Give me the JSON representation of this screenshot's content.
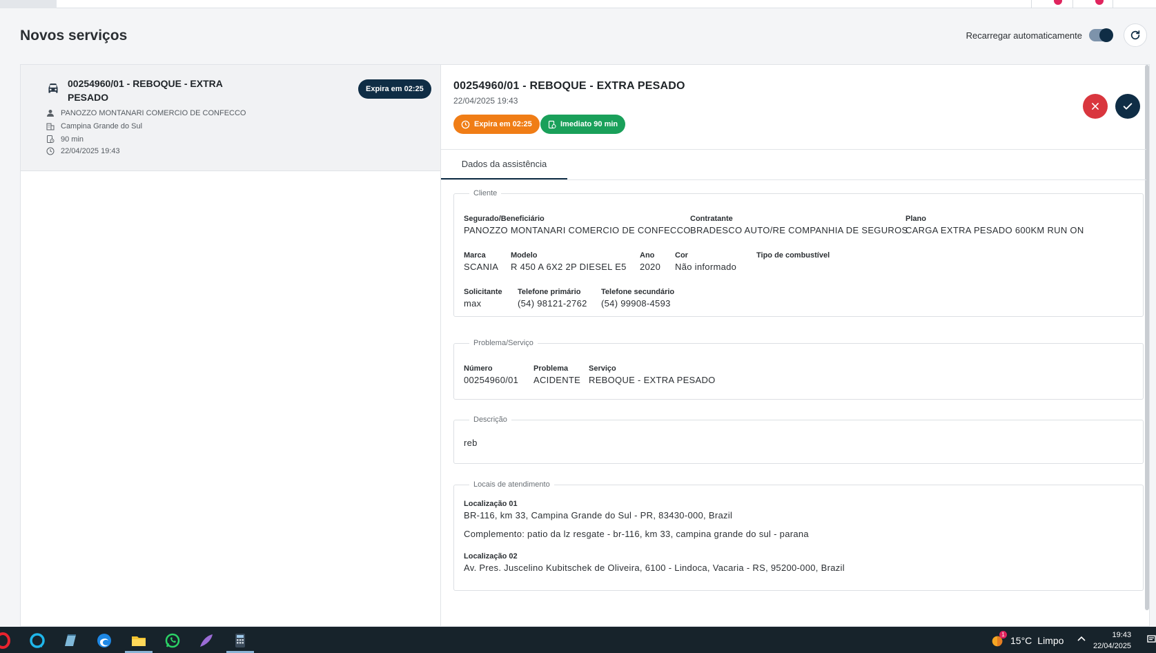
{
  "page": {
    "title": "Novos serviços",
    "auto_reload_label": "Recarregar automaticamente",
    "auto_reload_on": true
  },
  "list": {
    "items": [
      {
        "title": "00254960/01 - REBOQUE - EXTRA PESADO",
        "expire_badge": "Expira em 02:25",
        "client": "PANOZZO MONTANARI COMERCIO DE CONFECCO",
        "city": "Campina Grande do Sul",
        "duration": "90 min",
        "datetime": "22/04/2025 19:43"
      }
    ]
  },
  "detail": {
    "title": "00254960/01 - REBOQUE - EXTRA PESADO",
    "datetime": "22/04/2025 19:43",
    "chip_expire": "Expira em 02:25",
    "chip_immediate": "Imediato 90 min",
    "tab_label": "Dados da assistência",
    "cliente": {
      "legend": "Cliente",
      "segurado_label": "Segurado/Beneficiário",
      "segurado": "PANOZZO MONTANARI COMERCIO DE CONFECCO",
      "contratante_label": "Contratante",
      "contratante": "BRADESCO AUTO/RE COMPANHIA DE SEGUROS",
      "plano_label": "Plano",
      "plano": "CARGA EXTRA PESADO 600KM RUN ON",
      "marca_label": "Marca",
      "marca": "SCANIA",
      "modelo_label": "Modelo",
      "modelo": "R 450 A 6X2 2P DIESEL E5",
      "ano_label": "Ano",
      "ano": "2020",
      "cor_label": "Cor",
      "cor": "Não informado",
      "combustivel_label": "Tipo de combustível",
      "combustivel": "",
      "solicitante_label": "Solicitante",
      "solicitante": "max",
      "tel1_label": "Telefone primário",
      "tel1": "(54) 98121-2762",
      "tel2_label": "Telefone secundário",
      "tel2": "(54) 99908-4593"
    },
    "problema": {
      "legend": "Problema/Serviço",
      "numero_label": "Número",
      "numero": "00254960/01",
      "problema_label": "Problema",
      "problema": "ACIDENTE",
      "servico_label": "Serviço",
      "servico": "REBOQUE - EXTRA PESADO"
    },
    "descricao": {
      "legend": "Descrição",
      "text": "reb"
    },
    "locais": {
      "legend": "Locais de atendimento",
      "loc1_label": "Localização 01",
      "loc1": "BR-116, km 33, Campina Grande do Sul - PR, 83430-000, Brazil",
      "loc1_complemento": "Complemento: patio da lz resgate - br-116, km 33, campina grande do sul - parana",
      "loc2_label": "Localização 02",
      "loc2": "Av. Pres. Juscelino Kubitschek de Oliveira, 6100 - Lindoca, Vacaria - RS, 95200-000, Brazil"
    }
  },
  "taskbar": {
    "weather_temp": "15°C",
    "weather_desc": "Limpo",
    "weather_badge": "1",
    "time": "19:43",
    "date": "22/04/2025",
    "apps": [
      "opera-icon",
      "alexa-icon",
      "notepad-icon",
      "edge-icon",
      "file-explorer-icon",
      "whatsapp-icon",
      "feather-icon",
      "calculator-icon"
    ]
  },
  "colors": {
    "navy": "#0f2d45",
    "orange": "#f07d16",
    "green": "#1aa05a",
    "red": "#d9363e"
  }
}
